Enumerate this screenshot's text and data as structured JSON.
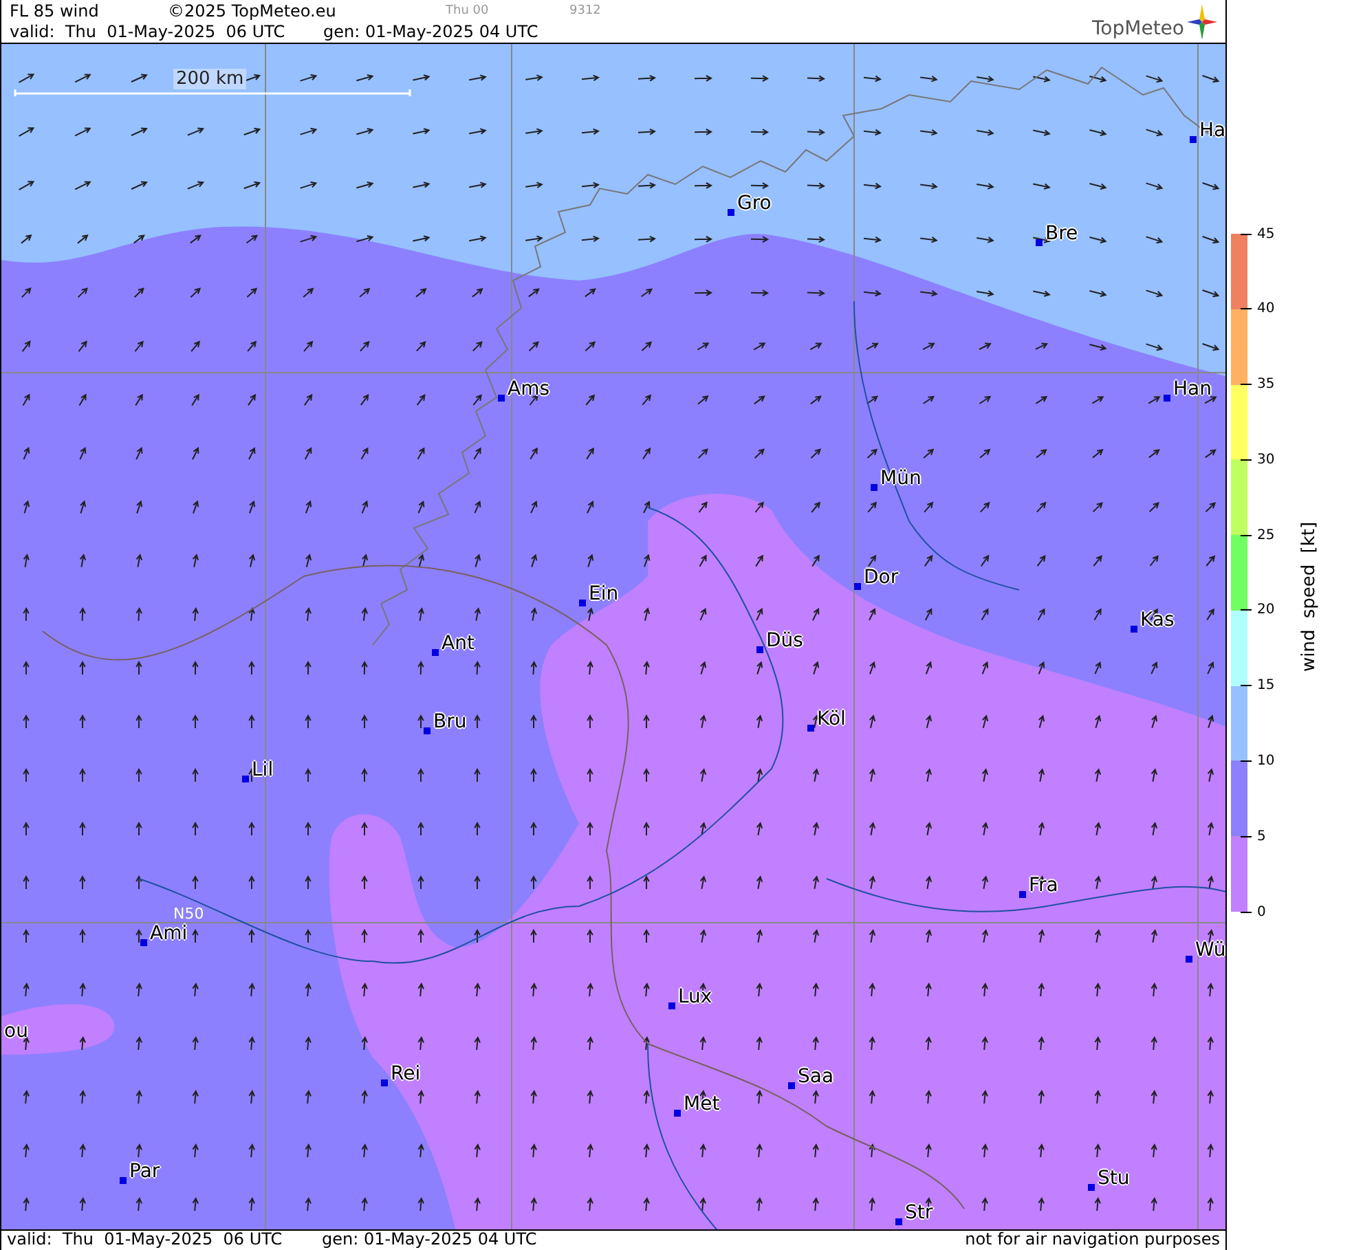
{
  "header": {
    "title": "FL 85 wind",
    "copyright": "©2025 TopMeteo.eu",
    "run_label": "Thu 00",
    "code": "9312",
    "valid": "valid:  Thu  01-May-2025  06 UTC",
    "generated": "gen: 01-May-2025 04 UTC",
    "logo": "TopMeteo"
  },
  "map": {
    "scale_label": "200 km",
    "grid_label": "N50",
    "cities": [
      {
        "name": "Ha"
      },
      {
        "name": "Gro"
      },
      {
        "name": "Bre"
      },
      {
        "name": "Ams"
      },
      {
        "name": "Han"
      },
      {
        "name": "Mün"
      },
      {
        "name": "Dor"
      },
      {
        "name": "Ein"
      },
      {
        "name": "Kas"
      },
      {
        "name": "Düs"
      },
      {
        "name": "Ant"
      },
      {
        "name": "Köl"
      },
      {
        "name": "Bru"
      },
      {
        "name": "Lil"
      },
      {
        "name": "Fra"
      },
      {
        "name": "Ami"
      },
      {
        "name": "Wü"
      },
      {
        "name": "Lux"
      },
      {
        "name": "ou"
      },
      {
        "name": "Rei"
      },
      {
        "name": "Saa"
      },
      {
        "name": "Met"
      },
      {
        "name": "Par"
      },
      {
        "name": "Stu"
      },
      {
        "name": "Str"
      }
    ]
  },
  "legend": {
    "title": "wind speed [kt]",
    "ticks": [
      "45",
      "40",
      "35",
      "30",
      "25",
      "20",
      "15",
      "10",
      "5",
      "0"
    ],
    "bands": [
      {
        "color": "#f08060"
      },
      {
        "color": "#ffb060"
      },
      {
        "color": "#ffff60"
      },
      {
        "color": "#c0ff60"
      },
      {
        "color": "#70ff60"
      },
      {
        "color": "#b0ffff"
      },
      {
        "color": "#96c0ff"
      },
      {
        "color": "#8c80ff"
      },
      {
        "color": "#c080ff"
      }
    ]
  },
  "footer": {
    "valid": "valid:  Thu  01-May-2025  06 UTC",
    "generated": "gen: 01-May-2025 04 UTC",
    "disclaimer": "not for air navigation purposes"
  }
}
